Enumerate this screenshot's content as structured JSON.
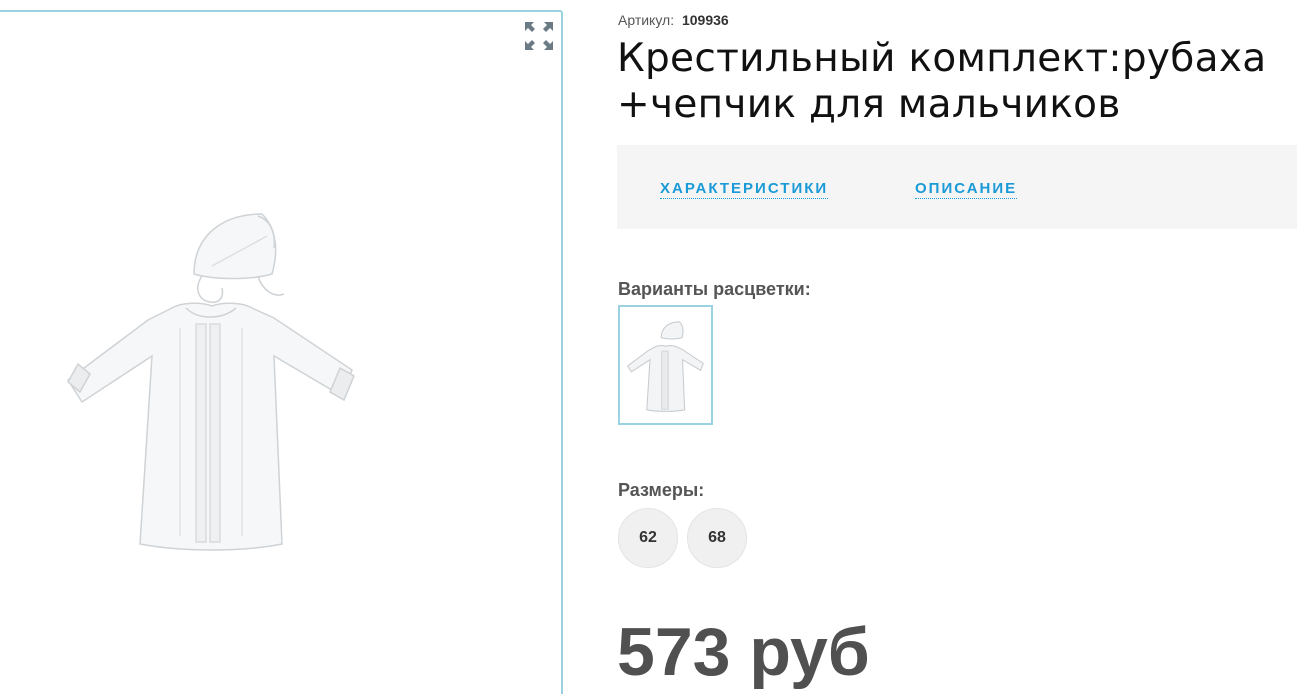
{
  "product": {
    "sku_label": "Артикул:",
    "sku_value": "109936",
    "title": "Крестильный комплект:рубаха +чепчик для мальчиков"
  },
  "tabs": [
    {
      "label": "ХАРАКТЕРИСТИКИ"
    },
    {
      "label": "ОПИСАНИЕ"
    }
  ],
  "colors": {
    "label": "Варианты расцветки:"
  },
  "sizes": {
    "label": "Размеры:",
    "options": [
      "62",
      "68"
    ]
  },
  "price": {
    "text": "573 руб"
  },
  "icons": {
    "fullscreen": "fullscreen-icon",
    "product_image": "christening-gown-image"
  },
  "theme": {
    "accent": "#1a9ad6",
    "border": "#9ad2e2",
    "price_color": "#505050"
  }
}
